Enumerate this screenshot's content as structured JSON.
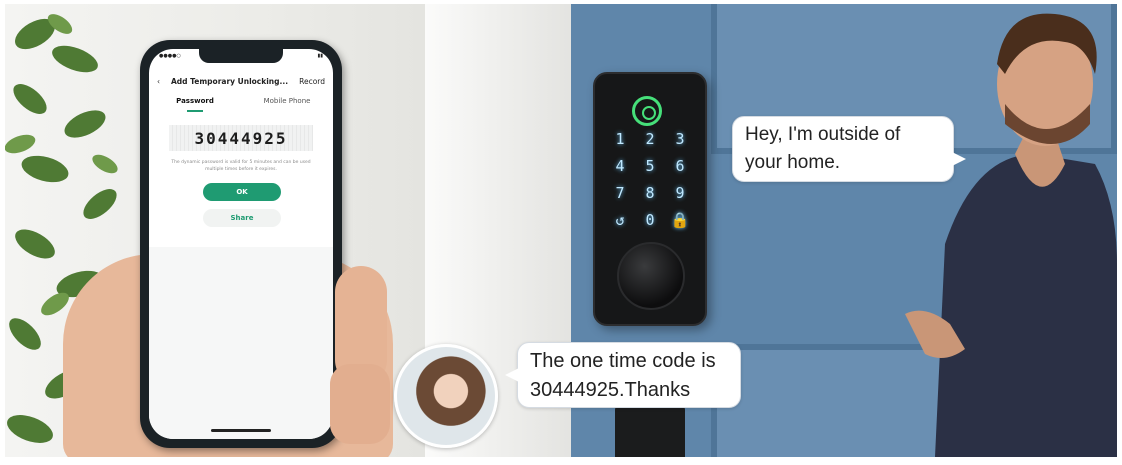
{
  "phone": {
    "status_signal": "●●●●○",
    "app_title": "Add Temporary Unlocking...",
    "record_label": "Record",
    "back_icon": "chevron-left-icon",
    "tabs": [
      {
        "label": "Password",
        "active": true
      },
      {
        "label": "Mobile Phone",
        "active": false
      }
    ],
    "password": "30444925",
    "note": "The dynamic password is valid for 5 minutes and can be used multiple times before it expires.",
    "ok_label": "OK",
    "share_label": "Share"
  },
  "lock": {
    "keys": [
      "1",
      "2",
      "3",
      "4",
      "5",
      "6",
      "7",
      "8",
      "9",
      "↺",
      "0",
      "🔒"
    ]
  },
  "bubbles": {
    "man_line": "Hey, I'm outside of your home.",
    "woman_line": "The one time code is 30444925.Thanks"
  },
  "colors": {
    "accent_green": "#1f9b72",
    "door_blue": "#5f86aa",
    "fingerprint_green": "#46e07a"
  }
}
